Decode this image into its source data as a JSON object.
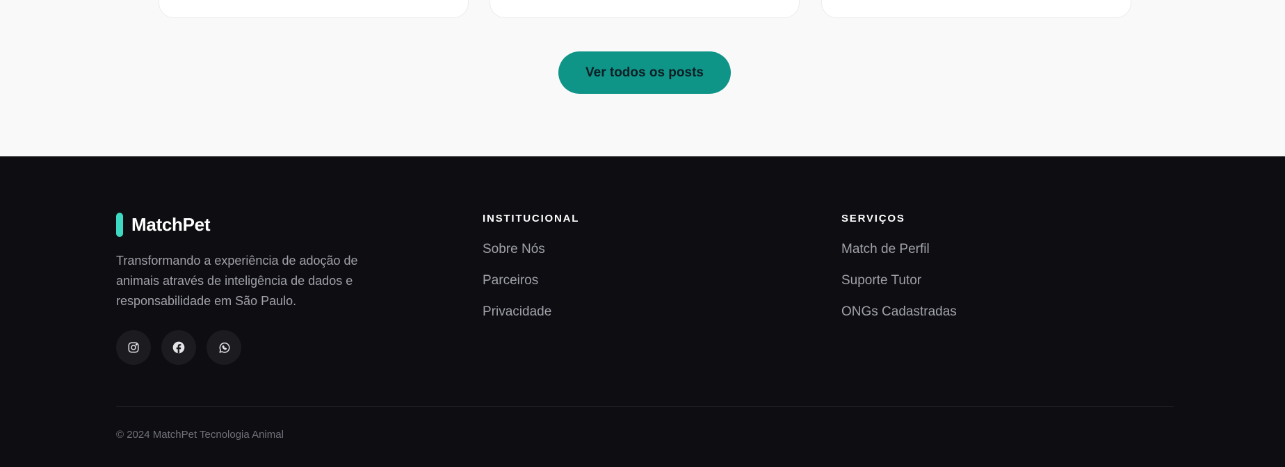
{
  "cta": {
    "label": "Ver todos os posts"
  },
  "footer": {
    "brand": {
      "name": "MatchPet",
      "accent_color": "#3ed9c2"
    },
    "tagline": "Transformando a experiência de adoção de animais através de inteligência de dados e responsabilidade em São Paulo.",
    "socials": [
      {
        "icon": "instagram-icon"
      },
      {
        "icon": "facebook-icon"
      },
      {
        "icon": "whatsapp-icon"
      }
    ],
    "institucional": {
      "heading": "INSTITUCIONAL",
      "links": [
        "Sobre Nós",
        "Parceiros",
        "Privacidade"
      ]
    },
    "servicos": {
      "heading": "SERVIÇOS",
      "links": [
        "Match de Perfil",
        "Suporte Tutor",
        "ONGs Cadastradas"
      ]
    },
    "copyright": "© 2024 MatchPet Tecnologia Animal"
  },
  "colors": {
    "cta_background": "#0f9488",
    "footer_background": "#0d0d12",
    "page_background": "#f9f9f9"
  }
}
